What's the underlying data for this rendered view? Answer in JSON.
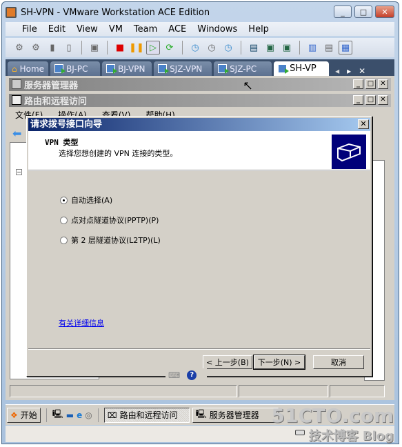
{
  "window": {
    "title": "SH-VPN - VMware Workstation ACE Edition",
    "minimize": "_",
    "maximize": "□",
    "close": "✕"
  },
  "menu": [
    "File",
    "Edit",
    "View",
    "VM",
    "Team",
    "ACE",
    "Windows",
    "Help"
  ],
  "tabs": [
    {
      "label": "Home",
      "icon": "home-icon"
    },
    {
      "label": "BJ-PC"
    },
    {
      "label": "BJ-VPN"
    },
    {
      "label": "SJZ-VPN"
    },
    {
      "label": "SJZ-PC"
    },
    {
      "label": "SH-VP",
      "active": true
    }
  ],
  "tab_nav": {
    "prev": "◂",
    "next": "▸",
    "close": "✕"
  },
  "guest": {
    "server_manager": {
      "title": "服务器管理器"
    },
    "rras": {
      "title": "路由和远程访问",
      "menu": [
        "文件(F)",
        "操作(A)",
        "查看(V)",
        "帮助(H)"
      ]
    },
    "dialog": {
      "title": "请求拨号接口向导",
      "close": "✕",
      "header_title": "VPN 类型",
      "header_subtitle": "选择您想创建的 VPN 连接的类型。",
      "options": [
        {
          "label": "自动选择(A)",
          "selected": true
        },
        {
          "label": "点对点隧道协议(PPTP)(P)",
          "selected": false
        },
        {
          "label": "第 2 层隧道协议(L2TP)(L)",
          "selected": false
        }
      ],
      "more_info_link": "有关详细信息",
      "buttons": {
        "back": "< 上一步(B)",
        "next": "下一步(N) >",
        "cancel": "取消"
      }
    },
    "taskbar": {
      "start": "开始",
      "items": [
        "路由和远程访问",
        "服务器管理器"
      ]
    }
  },
  "watermark": {
    "line1": "51CTO.com",
    "line2": "技术博客 Blog"
  },
  "colors": {
    "dialog_title_start": "#0a246a",
    "dialog_title_end": "#a6caf0",
    "tab_bar": "#3b4f6b"
  }
}
